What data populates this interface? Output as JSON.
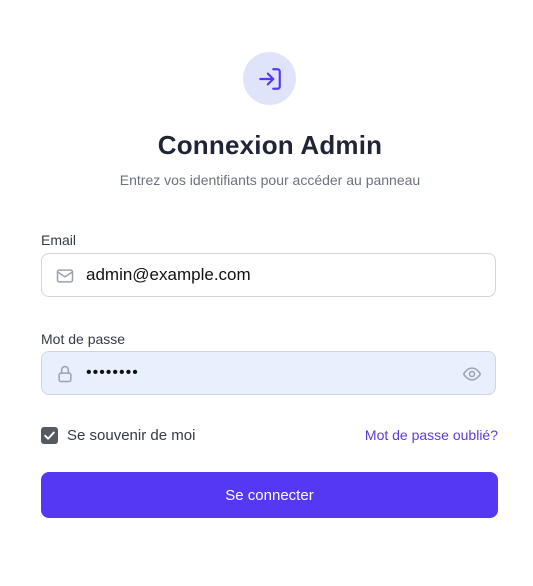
{
  "header": {
    "title": "Connexion Admin",
    "subtitle": "Entrez vos identifiants pour accéder au panneau",
    "icon": "login-icon"
  },
  "form": {
    "email": {
      "label": "Email",
      "value": "admin@example.com",
      "icon": "mail-icon"
    },
    "password": {
      "label": "Mot de passe",
      "value": "••••••••",
      "icon": "lock-icon",
      "toggle_icon": "eye-icon"
    },
    "remember": {
      "label": "Se souvenir de moi",
      "checked": true
    },
    "forgot_label": "Mot de passe oublié?",
    "submit_label": "Se connecter"
  },
  "colors": {
    "accent": "#5538f4",
    "link": "#5b3bdc",
    "icon_bg": "#e0e4fb",
    "autofill_bg": "#e8effd"
  }
}
